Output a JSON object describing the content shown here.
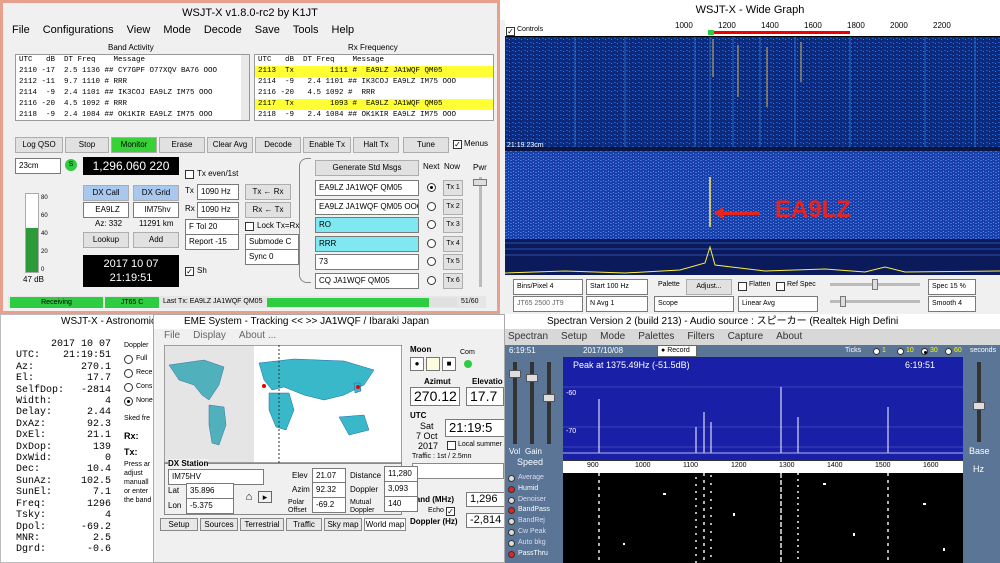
{
  "wsjt": {
    "title": "WSJT-X   v1.8.0-rc2   by K1JT",
    "menu": [
      "File",
      "Configurations",
      "View",
      "Mode",
      "Decode",
      "Save",
      "Tools",
      "Help"
    ],
    "band_activity": "Band Activity",
    "rx_frequency": "Rx Frequency",
    "ba_header": "UTC   dB  DT Freq    Message",
    "rx_header": "UTC   dB  DT Freq    Message",
    "ba_lines": [
      "2110 -17  2.5 1136 ## CY7GPF O77XQV BA76 OOO",
      "2112 -11  9.7 1110 # RRR",
      "2114  -9  2.4 1101 ## IK3COJ EA9LZ IM75 OOO",
      "2116 -20  4.5 1092 # RRR",
      "2118  -9  2.4 1084 ## OK1KIR EA9LZ IM75 OOO"
    ],
    "rx_lines": [
      {
        "t": "2113  Tx        1111 #  EA9LZ JA1WQF QM05",
        "hl": true
      },
      {
        "t": "2114  -9   2.4 1101 ## IK3COJ EA9LZ IM75 OOO",
        "hl": false
      },
      {
        "t": "2116 -20   4.5 1092 #  RRR",
        "hl": false
      },
      {
        "t": "2117  Tx        1093 #  EA9LZ JA1WQF QM05",
        "hl": true
      },
      {
        "t": "2118  -9   2.4 1084 ## OK1KIR EA9LZ IM75 OOO",
        "hl": false
      }
    ],
    "btn_log": "Log QSO",
    "btn_stop": "Stop",
    "btn_monitor": "Monitor",
    "btn_erase": "Erase",
    "btn_clear": "Clear Avg",
    "btn_decode": "Decode",
    "btn_enable": "Enable Tx",
    "btn_halt": "Halt Tx",
    "btn_tune": "Tune",
    "menus_label": "Menus",
    "band": "23cm",
    "freq": "1,296.060 220",
    "s_label": "S",
    "tx_even": "Tx even/1st",
    "tx_label": "Tx",
    "tx_freq": "1090 Hz",
    "rx_label": "Rx",
    "rx_freq": "1090 Hz",
    "tx_from_rx": "Tx ← Rx",
    "rx_from_tx": "Rx ← Tx",
    "ftol": "F Tol  20",
    "lock": "Lock Tx=Rx",
    "report": "Report -15",
    "submode": "Submode C",
    "sync": "Sync  0",
    "dx_call_btn": "DX Call",
    "dx_grid_btn": "DX Grid",
    "dx_call": "EA9LZ",
    "dx_grid": "IM75hv",
    "az": "Az: 332",
    "dist": "11291 km",
    "lookup": "Lookup",
    "add": "Add",
    "date": "2017 10 07",
    "time": "21:19:51",
    "sh": "Sh",
    "gen_msgs": "Generate Std Msgs",
    "next": "Next",
    "now": "Now",
    "msgs": [
      "EA9LZ JA1WQF QM05",
      "EA9LZ JA1WQF QM05 OOO",
      "RO",
      "RRR",
      "73",
      "CQ JA1WQF QM05"
    ],
    "tx_btns": [
      "Tx 1",
      "Tx 2",
      "Tx 3",
      "Tx 4",
      "Tx 5",
      "Tx 6"
    ],
    "pwr": "Pwr",
    "meter_ticks": [
      "80",
      "60",
      "40",
      "20",
      "0"
    ],
    "meter_db": "47 dB",
    "status_rx": "Receiving",
    "status_mode": "JT65 C",
    "status_last": "Last Tx: EA9LZ JA1WQF QM05",
    "status_count": "51/60"
  },
  "wide": {
    "title": "WSJT-X - Wide Graph",
    "controls": "Controls",
    "ticks": [
      "1000",
      "1200",
      "1400",
      "1600",
      "1800",
      "2000",
      "2200"
    ],
    "time_mark": "21:19  23cm",
    "label": "EA9LZ",
    "label_color": "#e8231c",
    "bins": "Bins/Pixel  4",
    "start": "Start 100 Hz",
    "palette": "Palette",
    "adjust": "Adjust...",
    "flatten": "Flatten",
    "refspec": "Ref Spec",
    "spec": "Spec 15 %",
    "jt65": "JT65  2500  JT9",
    "navg": "N Avg  1",
    "scope": "Scope",
    "linavg": "Linear Avg",
    "smooth": "Smooth  4"
  },
  "astro": {
    "title": "WSJT-X - Astronomical Data",
    "rows": [
      [
        "",
        "2017 10 07"
      ],
      [
        "UTC:",
        "21:19:51"
      ],
      [
        "Az:",
        "270.1"
      ],
      [
        "El:",
        "17.7"
      ],
      [
        "SelfDop:",
        "-2814"
      ],
      [
        "Width:",
        "4"
      ],
      [
        "Delay:",
        "2.44"
      ],
      [
        "DxAz:",
        "92.3"
      ],
      [
        "DxEl:",
        "21.1"
      ],
      [
        "DxDop:",
        "139"
      ],
      [
        "DxWid:",
        "0"
      ],
      [
        "Dec:",
        "10.4"
      ],
      [
        "SunAz:",
        "102.5"
      ],
      [
        "SunEl:",
        "7.1"
      ],
      [
        "Freq:",
        "1296"
      ],
      [
        "Tsky:",
        "4"
      ],
      [
        "Dpol:",
        "-69.2"
      ],
      [
        "MNR:",
        "2.5"
      ],
      [
        "Dgrd:",
        "-0.6"
      ]
    ],
    "doppler": "Doppler",
    "opts": [
      "Full",
      "Rece",
      "Cons",
      "None"
    ],
    "sked": "Sked fre",
    "rx": "Rx:",
    "tx": "Tx:",
    "press": [
      "Press ar",
      "adjust",
      "manuall",
      "or enter",
      "the band"
    ]
  },
  "eme": {
    "title": "EME System - Tracking << >> JA1WQF / Ibaraki Japan",
    "menu": [
      "File",
      "Display",
      "About ..."
    ],
    "moon": "Moon",
    "com": "Com",
    "azimut": "Azimut",
    "elevation": "Elevatio",
    "az_val": "270.12",
    "el_val": "17.7",
    "utc": "UTC",
    "day": "Sat",
    "date": "7 Oct",
    "year": "2017",
    "utc_time": "21:19:5",
    "local": "Local summer",
    "traffic": "Traffic : 1st / 2.5mn",
    "band_mhz": "Band (MHz)",
    "band_val": "1,296",
    "echo": "Echo",
    "dopp_hz": "Doppler (Hz)",
    "dopp_val": "-2,814",
    "dx_station": "DX Station",
    "dx_grid": "IM75HV",
    "lat_l": "Lat",
    "lat": "35.896",
    "lon_l": "Lon",
    "lon": "-5.375",
    "elev_l": "Elev",
    "elev": "21.07",
    "dist_l": "Distance",
    "dist": "11,280",
    "azim_l": "Azim",
    "azim": "92.32",
    "dop_l": "Doppler",
    "dop": "3,093",
    "pol_l": "Polar Offset",
    "pol": "-69.2",
    "mut_l": "Mutual Doppler",
    "mut": "140",
    "tabs": [
      "Setup",
      "Sources",
      "Terrestrial",
      "Traffic",
      "Sky map",
      "World map"
    ]
  },
  "spectran": {
    "title": "Spectran Version 2  (build 213) - Audio source : スピーカー (Realtek High Defini",
    "menu": [
      "Spectran",
      "Setup",
      "Mode",
      "Palettes",
      "Filters",
      "Capture",
      "About"
    ],
    "time": "6:19:51",
    "date": "2017/10/08",
    "record": "Record",
    "ticks_label": "Ticks",
    "tick_opts": [
      "1",
      "10",
      "30",
      "60"
    ],
    "seconds": "seconds",
    "peak": "Peak at 1375.49Hz (-51.5dB)",
    "peak_time": "6:19:51",
    "ylabels": [
      "-60",
      "-70"
    ],
    "xlabels": [
      "900",
      "1000",
      "1100",
      "1200",
      "1300",
      "1400",
      "1500",
      "1600"
    ],
    "vol": "Vol",
    "gain": "Gain",
    "speed": "Speed",
    "base": "Base",
    "hz": "Hz",
    "opts": [
      "Average",
      "Humid",
      "Denoiser",
      "BandPass",
      "BandRej",
      "Cw Peak",
      "Auto bkg",
      "PassThru"
    ]
  }
}
